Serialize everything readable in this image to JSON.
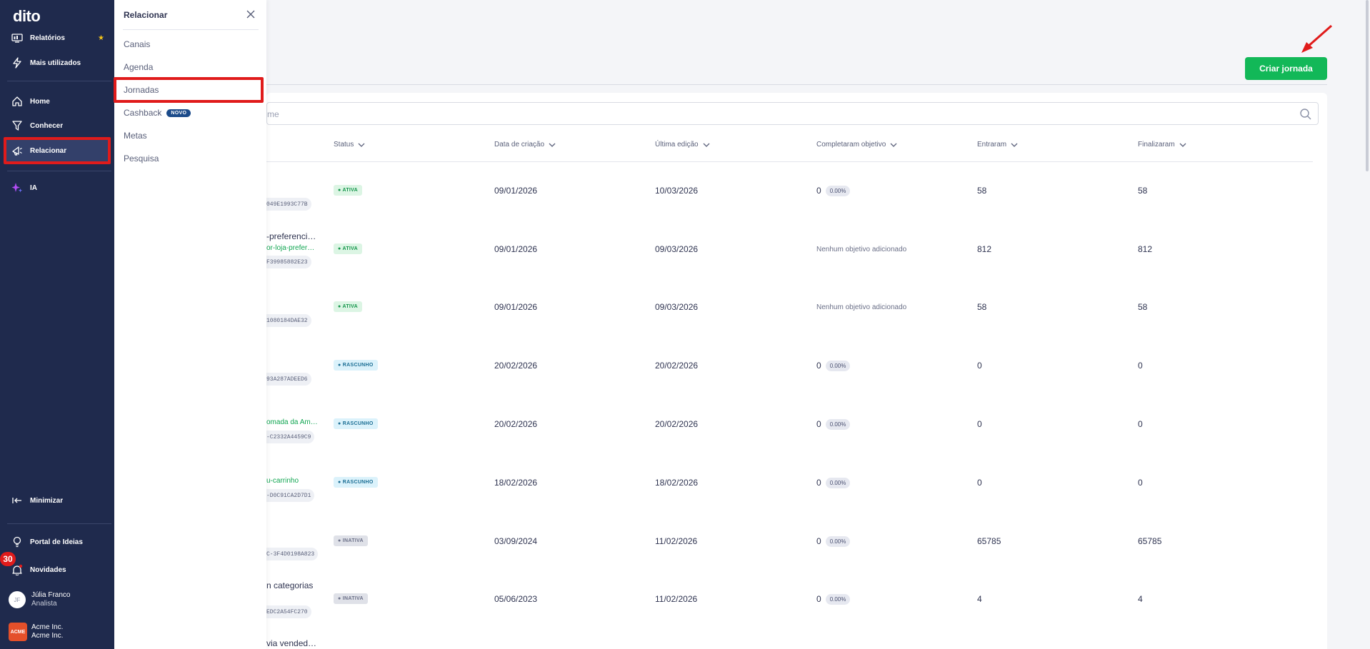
{
  "sidebar": {
    "logo": "dito",
    "items": [
      {
        "label": "Relatórios",
        "icon": "reports-icon"
      },
      {
        "label": "Mais utilizados",
        "icon": "lightning-icon"
      },
      {
        "label": "Home",
        "icon": "home-icon"
      },
      {
        "label": "Conhecer",
        "icon": "funnel-icon"
      },
      {
        "label": "Relacionar",
        "icon": "megaphone-icon"
      },
      {
        "label": "IA",
        "icon": "sparkle-icon"
      },
      {
        "label": "Minimizar",
        "icon": "collapse-icon"
      },
      {
        "label": "Portal de Ideias",
        "icon": "bulb-icon"
      },
      {
        "label": "Novidades",
        "icon": "bell-icon"
      }
    ],
    "notifications_count": "30",
    "user": {
      "initials": "JF",
      "name": "Júlia Franco",
      "role": "Analista"
    },
    "company": {
      "logo_text": "ACME",
      "name": "Acme Inc.",
      "subname": "Acme Inc."
    }
  },
  "submenu": {
    "title": "Relacionar",
    "items": [
      {
        "label": "Canais"
      },
      {
        "label": "Agenda"
      },
      {
        "label": "Jornadas"
      },
      {
        "label": "Cashback",
        "badge": "NOVO"
      },
      {
        "label": "Metas"
      },
      {
        "label": "Pesquisa"
      }
    ]
  },
  "main": {
    "create_button": "Criar jornada",
    "search_placeholder": "me",
    "columns": [
      "Status",
      "Data de criação",
      "Última edição",
      "Completaram objetivo",
      "Entraram",
      "Finalizaram"
    ],
    "rows": [
      {
        "name": "",
        "link": "",
        "id": "049E1993C77B",
        "status": "ATIVA",
        "status_type": "ativa",
        "created": "09/01/2026",
        "edited": "10/03/2026",
        "goal": "0",
        "pct": "0.00%",
        "entered": "58",
        "finished": "58"
      },
      {
        "name": "-preferenci…",
        "link": "or-loja-prefer…",
        "id": "F39985882E23",
        "status": "ATIVA",
        "status_type": "ativa",
        "created": "09/01/2026",
        "edited": "09/03/2026",
        "goal_text": "Nenhum objetivo adicionado",
        "entered": "812",
        "finished": "812"
      },
      {
        "name": "",
        "link": "",
        "id": "1080184DAE32",
        "status": "ATIVA",
        "status_type": "ativa",
        "created": "09/01/2026",
        "edited": "09/03/2026",
        "goal_text": "Nenhum objetivo adicionado",
        "entered": "58",
        "finished": "58"
      },
      {
        "name": "",
        "link": "",
        "id": "93A287ADEED6",
        "status": "RASCUNHO",
        "status_type": "rascunho",
        "created": "20/02/2026",
        "edited": "20/02/2026",
        "goal": "0",
        "pct": "0.00%",
        "entered": "0",
        "finished": "0"
      },
      {
        "name": "",
        "link": "omada da Am…",
        "id": "-C2332A4459C9",
        "status": "RASCUNHO",
        "status_type": "rascunho",
        "created": "20/02/2026",
        "edited": "20/02/2026",
        "goal": "0",
        "pct": "0.00%",
        "entered": "0",
        "finished": "0"
      },
      {
        "name": "",
        "link": "u-carrinho",
        "id": "-D0C91CA2D7D1",
        "status": "RASCUNHO",
        "status_type": "rascunho",
        "created": "18/02/2026",
        "edited": "18/02/2026",
        "goal": "0",
        "pct": "0.00%",
        "entered": "0",
        "finished": "0"
      },
      {
        "name": "",
        "link": "",
        "id": "C-3F4D0198A823",
        "status": "INATIVA",
        "status_type": "inativa",
        "created": "03/09/2024",
        "edited": "11/02/2026",
        "goal": "0",
        "pct": "0.00%",
        "entered": "65785",
        "finished": "65785"
      },
      {
        "name": "n categorias",
        "link": "",
        "id": "EDC2A54FC270",
        "status": "INATIVA",
        "status_type": "inativa",
        "created": "05/06/2023",
        "edited": "11/02/2026",
        "goal": "0",
        "pct": "0.00%",
        "entered": "4",
        "finished": "4"
      },
      {
        "name": "via vended…",
        "link": "",
        "id": "",
        "status": "",
        "status_type": "",
        "created": "",
        "edited": "",
        "entered": "",
        "finished": ""
      }
    ]
  },
  "colors": {
    "sidebar": "#1f2a4d",
    "accent_green": "#12b858",
    "highlight_red": "#e01b1b"
  }
}
